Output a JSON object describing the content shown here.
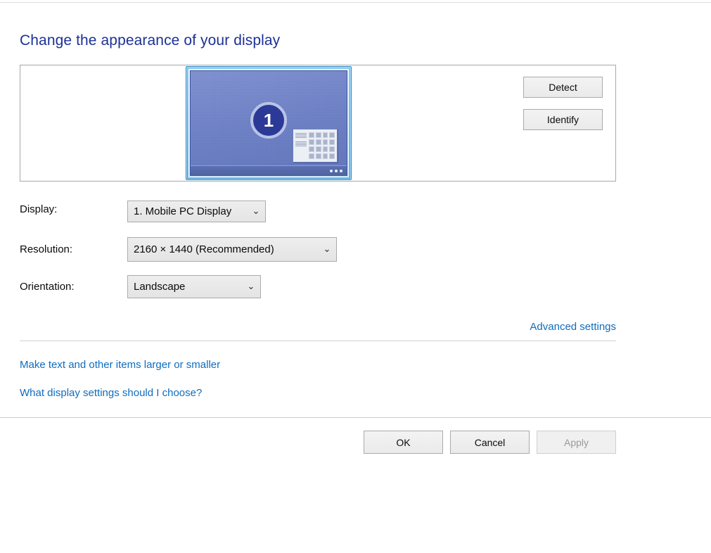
{
  "page": {
    "title": "Change the appearance of your display"
  },
  "preview": {
    "display_number": "1",
    "monitor_label": "display-monitor-preview"
  },
  "actions": {
    "detect_label": "Detect",
    "identify_label": "Identify"
  },
  "settings": {
    "display": {
      "label": "Display:",
      "value": "1. Mobile PC Display"
    },
    "resolution": {
      "label": "Resolution:",
      "value": "2160 × 1440 (Recommended)"
    },
    "orientation": {
      "label": "Orientation:",
      "value": "Landscape"
    }
  },
  "links": {
    "advanced_settings": "Advanced settings",
    "make_text_larger": "Make text and other items larger or smaller",
    "what_settings": "What display settings should I choose?"
  },
  "footer": {
    "ok_label": "OK",
    "cancel_label": "Cancel",
    "apply_label": "Apply",
    "apply_enabled": false
  },
  "icons": {
    "chevron_down": "⌄"
  },
  "colors": {
    "heading": "#1c3196",
    "link": "#0f6cbd",
    "monitor_frame": "#4aa8e2",
    "desktop": "#6d80c4",
    "badge": "#2b3a96"
  }
}
